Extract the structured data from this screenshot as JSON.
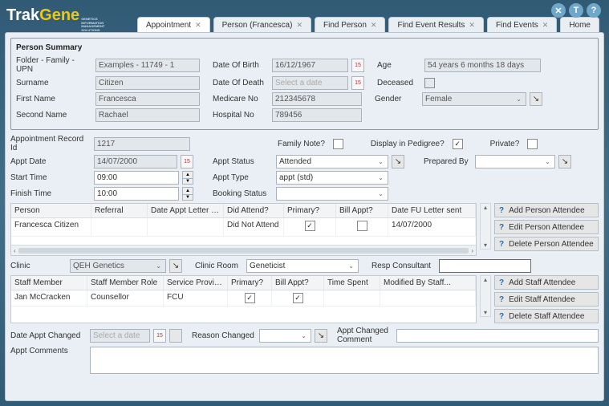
{
  "header": {
    "logo_trak": "Trak",
    "logo_gene": "Gene",
    "logo_sub1": "GENETICS",
    "logo_sub2": "INFORMATION",
    "logo_sub3": "MANAGEMENT",
    "logo_sub4": "SOLUTIONS",
    "icons": {
      "close": "✕",
      "info": "T",
      "help": "?"
    }
  },
  "tabs": [
    {
      "label": "Appointment",
      "closable": true,
      "active": true
    },
    {
      "label": "Person (Francesca)",
      "closable": true
    },
    {
      "label": "Find Person",
      "closable": true
    },
    {
      "label": "Find Event Results",
      "closable": true
    },
    {
      "label": "Find Events",
      "closable": true
    },
    {
      "label": "Home",
      "closable": false
    }
  ],
  "summary": {
    "title": "Person Summary",
    "folder_lbl": "Folder - Family - UPN",
    "folder_val": "Examples - 11749 - 1",
    "surname_lbl": "Surname",
    "surname_val": "Citizen",
    "first_lbl": "First Name",
    "first_val": "Francesca",
    "second_lbl": "Second Name",
    "second_val": "Rachael",
    "dob_lbl": "Date Of Birth",
    "dob_val": "16/12/1967",
    "dod_lbl": "Date Of Death",
    "dod_val": "Select a date",
    "medicare_lbl": "Medicare No",
    "medicare_val": "212345678",
    "hospital_lbl": "Hospital No",
    "hospital_val": "789456",
    "age_lbl": "Age",
    "age_val": "54 years 6 months 18 days",
    "deceased_lbl": "Deceased",
    "gender_lbl": "Gender",
    "gender_val": "Female"
  },
  "appt": {
    "recid_lbl": "Appointment Record Id",
    "recid_val": "1217",
    "family_note_lbl": "Family Note?",
    "display_pedigree_lbl": "Display in Pedigree?",
    "display_pedigree_chk": "✓",
    "private_lbl": "Private?",
    "date_lbl": "Appt Date",
    "date_val": "14/07/2000",
    "status_lbl": "Appt Status",
    "status_val": "Attended",
    "prepared_lbl": "Prepared By",
    "prepared_val": "",
    "start_lbl": "Start Time",
    "start_val": "09:00",
    "type_lbl": "Appt Type",
    "type_val": "appt (std)",
    "finish_lbl": "Finish Time",
    "finish_val": "10:00",
    "booking_lbl": "Booking Status",
    "booking_val": ""
  },
  "person_grid": {
    "cols": [
      "Person",
      "Referral",
      "Date Appt Letter s...",
      "Did Attend?",
      "Primary?",
      "Bill Appt?",
      "Date FU Letter sent"
    ],
    "row": {
      "person": "Francesca Citizen",
      "referral": "",
      "letter": "",
      "attend": "Did Not Attend",
      "primary_chk": "✓",
      "bill_chk": "",
      "fu": "14/07/2000"
    },
    "btn_add": "Add Person Attendee",
    "btn_edit": "Edit Person Attendee",
    "btn_del": "Delete Person Attendee"
  },
  "clinic": {
    "clinic_lbl": "Clinic",
    "clinic_val": "QEH Genetics",
    "room_lbl": "Clinic Room",
    "room_val": "Geneticist",
    "resp_lbl": "Resp Consultant",
    "resp_val": ""
  },
  "staff_grid": {
    "cols": [
      "Staff Member",
      "Staff Member Role",
      "Service Provider",
      "Primary?",
      "Bill Appt?",
      "Time Spent",
      "Modified By Staff..."
    ],
    "row": {
      "member": "Jan McCracken",
      "role": "Counsellor",
      "provider": "FCU",
      "primary_chk": "✓",
      "bill_chk": "✓",
      "time": "",
      "mod": ""
    },
    "btn_add": "Add Staff Attendee",
    "btn_edit": "Edit Staff Attendee",
    "btn_del": "Delete Staff Attendee"
  },
  "footer": {
    "changed_lbl": "Date Appt Changed",
    "changed_val": "Select a date",
    "reason_lbl": "Reason Changed",
    "reason_val": "",
    "comment_lbl": "Appt Changed Comment",
    "comments_lbl": "Appt Comments"
  }
}
